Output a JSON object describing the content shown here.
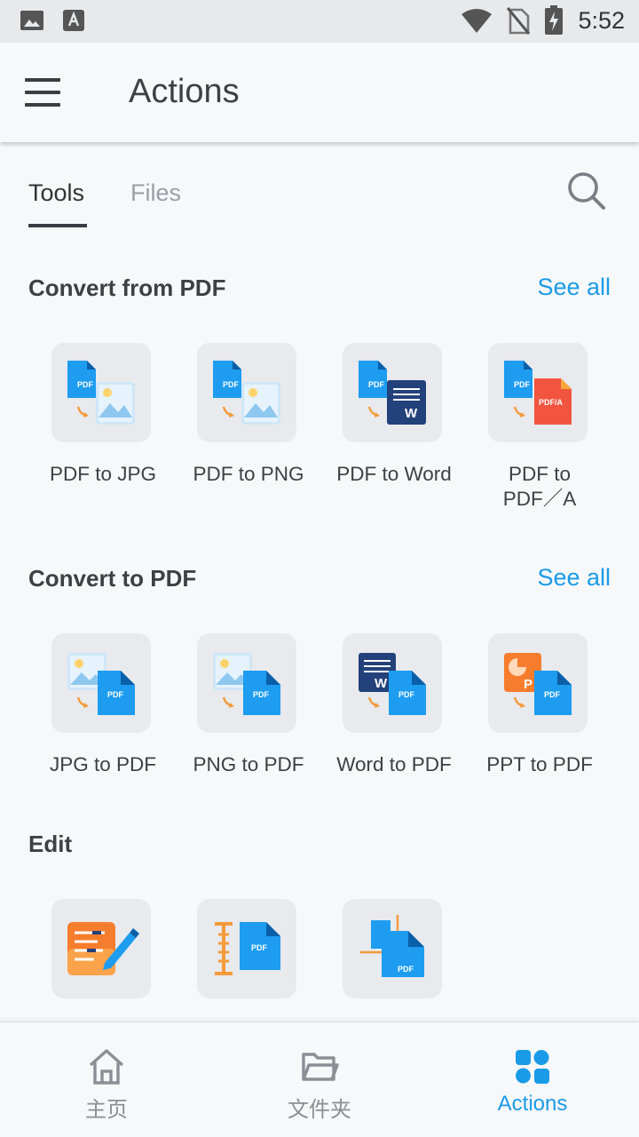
{
  "status_bar": {
    "time": "5:52"
  },
  "app_bar": {
    "title": "Actions"
  },
  "tabs": [
    {
      "label": "Tools",
      "active": true
    },
    {
      "label": "Files",
      "active": false
    }
  ],
  "sections": [
    {
      "title": "Convert from PDF",
      "see_all": "See all",
      "tools": [
        {
          "label": "PDF to JPG",
          "icon": "pdf-to-jpg-icon"
        },
        {
          "label": "PDF to PNG",
          "icon": "pdf-to-png-icon"
        },
        {
          "label": "PDF to Word",
          "icon": "pdf-to-word-icon"
        },
        {
          "label": "PDF to\nPDF／A",
          "icon": "pdf-to-pdfa-icon"
        }
      ]
    },
    {
      "title": "Convert to PDF",
      "see_all": "See all",
      "tools": [
        {
          "label": "JPG to PDF",
          "icon": "jpg-to-pdf-icon"
        },
        {
          "label": "PNG to PDF",
          "icon": "png-to-pdf-icon"
        },
        {
          "label": "Word to PDF",
          "icon": "word-to-pdf-icon"
        },
        {
          "label": "PPT to PDF",
          "icon": "ppt-to-pdf-icon"
        }
      ]
    },
    {
      "title": "Edit",
      "tools": [
        {
          "icon": "edit-text-icon"
        },
        {
          "icon": "compress-pdf-icon"
        },
        {
          "icon": "crop-pdf-icon"
        }
      ]
    }
  ],
  "icon_text": {
    "pdf": "PDF",
    "pdfa": "PDF/A",
    "w": "W",
    "p": "P"
  },
  "bottom_nav": [
    {
      "label": "主页",
      "icon": "home-icon",
      "active": false
    },
    {
      "label": "文件夹",
      "icon": "folder-icon",
      "active": false
    },
    {
      "label": "Actions",
      "icon": "actions-grid-icon",
      "active": true
    }
  ],
  "colors": {
    "accent": "#1a9be8",
    "pdf_blue": "#1d9cf0",
    "word_navy": "#23417a",
    "pdfa_red": "#f2553f",
    "arrow_orange": "#f39a3a"
  }
}
